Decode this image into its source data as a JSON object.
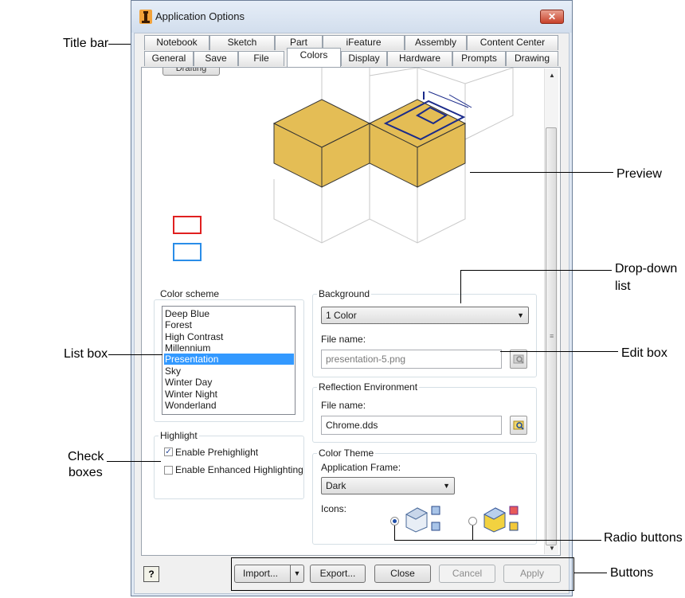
{
  "window": {
    "title": "Application Options"
  },
  "tabs": {
    "row1": [
      "Notebook",
      "Sketch",
      "Part",
      "iFeature",
      "Assembly",
      "Content Center"
    ],
    "row2": [
      "General",
      "Save",
      "File",
      "Colors",
      "Display",
      "Hardware",
      "Prompts",
      "Drawing"
    ],
    "active": "Colors"
  },
  "preview": {
    "partial_button": "Drafting"
  },
  "color_scheme": {
    "label": "Color scheme",
    "items": [
      "Deep Blue",
      "Forest",
      "High Contrast",
      "Millennium",
      "Presentation",
      "Sky",
      "Winter Day",
      "Winter Night",
      "Wonderland"
    ],
    "selected": "Presentation"
  },
  "highlight": {
    "label": "Highlight",
    "prehighlight": {
      "label": "Enable Prehighlight",
      "checked": true
    },
    "enhanced": {
      "label": "Enable Enhanced Highlighting",
      "checked": false
    }
  },
  "background": {
    "label": "Background",
    "selected": "1 Color",
    "file_label": "File name:",
    "file_value": "presentation-5.png"
  },
  "reflection": {
    "label": "Reflection Environment",
    "file_label": "File name:",
    "file_value": "Chrome.dds"
  },
  "color_theme": {
    "label": "Color Theme",
    "frame_label": "Application Frame:",
    "frame_value": "Dark",
    "icons_label": "Icons:"
  },
  "buttons": {
    "help": "?",
    "import": "Import...",
    "export": "Export...",
    "close": "Close",
    "cancel": "Cancel",
    "apply": "Apply"
  },
  "callouts": {
    "title_bar": "Title bar",
    "preview": "Preview",
    "dropdown_1": "Drop-down",
    "dropdown_2": "list",
    "list_box": "List box",
    "edit_box": "Edit box",
    "check_1": "Check",
    "check_2": "boxes",
    "radio": "Radio buttons",
    "buttons": "Buttons"
  },
  "colors": {
    "cube_face": "#e4bd55",
    "selection": "#3399ff",
    "highlight_red": "#e02020",
    "highlight_blue": "#2a8de8",
    "title_gradient": "#d2deed"
  }
}
